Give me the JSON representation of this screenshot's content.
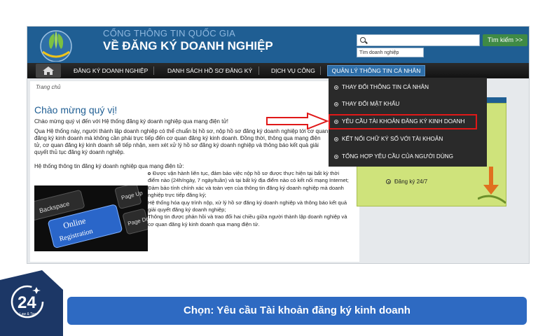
{
  "header": {
    "portal_top": "CỔNG THÔNG TIN QUỐC GIA",
    "portal_main": "VỀ ĐĂNG KÝ DOANH NGHIỆP",
    "search_button": "Tìm kiếm >>",
    "search_hint": "Tìm doanh nghiệp"
  },
  "nav": {
    "items": [
      {
        "label": "ĐĂNG KÝ DOANH NGHIỆP"
      },
      {
        "label": "DANH SÁCH HỒ SƠ ĐĂNG KÝ"
      },
      {
        "label": "DỊCH VỤ CÔNG"
      }
    ],
    "active": "QUẢN LÝ THÔNG TIN CÁ NHÂN"
  },
  "dropdown": {
    "items": [
      {
        "label": "THAY ĐỔI THÔNG TIN CÁ NHÂN"
      },
      {
        "label": "THAY ĐỔI MẬT KHẨU"
      },
      {
        "label": "YÊU CẦU TÀI KHOẢN ĐĂNG KÝ KINH DOANH"
      },
      {
        "label": "KẾT NỐI CHỮ KÝ SỐ VỚI TÀI KHOẢN"
      },
      {
        "label": "TỔNG HỢP YÊU CẦU CỦA NGƯỜI DÙNG"
      }
    ]
  },
  "content": {
    "breadcrumb": "Trang chủ",
    "welcome": "Chào mừng quý vị!",
    "p1": "Chào mừng quý vị đến với Hệ thống đăng ký doanh nghiệp qua mạng điện tử!",
    "p2": "Qua Hệ thống này, người thành lập doanh nghiệp có thể chuẩn bị hồ sơ, nộp hồ sơ đăng ký doanh nghiệp tới cơ quan đăng ký kinh doanh mà không cần phải trực tiếp đến cơ quan đăng ký kinh doanh. Đồng thời, thông qua mạng điện tử, cơ quan đăng ký kinh doanh sẽ tiếp nhận, xem xét xử lý hồ sơ đăng ký doanh nghiệp và thông báo kết quả giải quyết thủ tục đăng ký doanh nghiệp.",
    "p3": "Hệ thống thông tin đăng ký doanh nghiệp qua mạng điện tử:",
    "bullets": [
      "Được vận hành liên tục, đảm bảo việc nộp hồ sơ được thực hiện tại bất kỳ thời điểm nào (24h/ngày, 7 ngày/tuần) và tại bất kỳ địa điểm nào có kết nối mạng Internet;",
      "Đảm bảo tính chính xác và toàn vẹn của thông tin đăng ký doanh nghiệp mà doanh nghiệp trực tiếp đăng ký;",
      "Hệ thống hóa quy trình nộp, xử lý hồ sơ đăng ký doanh nghiệp và thông báo kết quả giải quyết đăng ký doanh nghiệp;",
      "Thông tin được phản hồi và trao đổi hai chiều giữa người thành lập doanh nghiệp và cơ quan đăng ký kinh doanh qua mạng điện tử."
    ],
    "keyboard_keys": [
      "Backspace",
      "Online",
      "Registration",
      "Page Up",
      "Page Down"
    ]
  },
  "side_panel": {
    "item": "Đăng ký 24/7"
  },
  "footer": {
    "caption": "Chọn: Yêu cầu Tài khoản đăng ký kinh doanh",
    "badge_number": "24",
    "badge_text": "Law & Tax"
  },
  "colors": {
    "banner": "#1f5e93",
    "caption_bar": "#2e6ac2",
    "highlight": "#e01818",
    "green_panel": "#cfe37b"
  }
}
